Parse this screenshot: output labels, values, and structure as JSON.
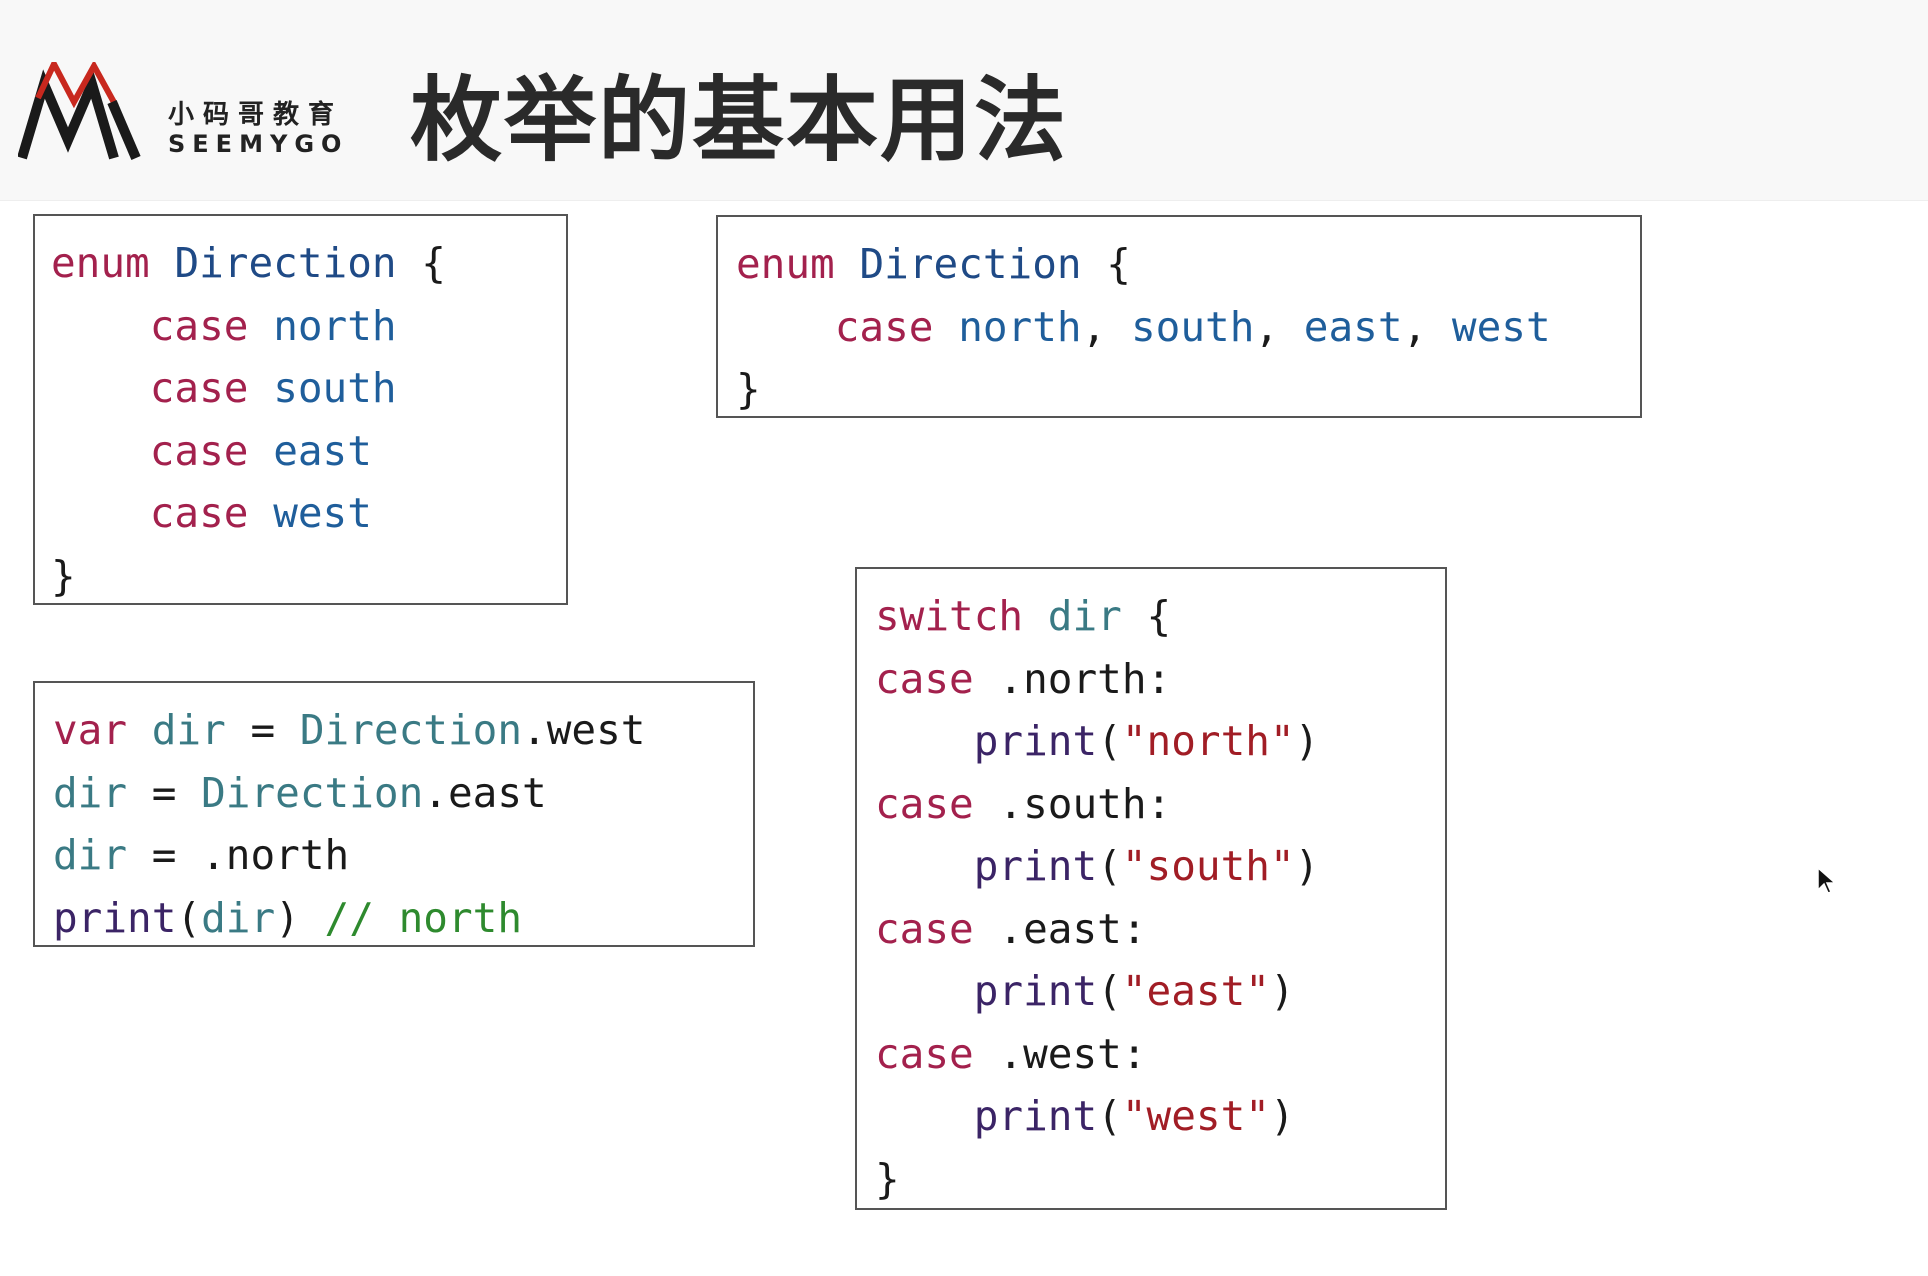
{
  "logo": {
    "cn_text": "小码哥教育",
    "en_text": "SEEMYGO",
    "colors": {
      "mark_dark": "#1a1a1a",
      "mark_red": "#c8281e"
    }
  },
  "title": "枚举的基本用法",
  "code_blocks": {
    "enum_separate": {
      "line1": {
        "kw": "enum",
        "name": "Direction",
        "brace": "{"
      },
      "cases": [
        {
          "kw": "case",
          "value": "north"
        },
        {
          "kw": "case",
          "value": "south"
        },
        {
          "kw": "case",
          "value": "east"
        },
        {
          "kw": "case",
          "value": "west"
        }
      ],
      "close": "}"
    },
    "enum_compact": {
      "line1": {
        "kw": "enum",
        "name": "Direction",
        "brace": "{"
      },
      "line2": {
        "kw": "case",
        "v1": "north",
        "v2": "south",
        "v3": "east",
        "v4": "west",
        "sep": ","
      },
      "close": "}"
    },
    "var_usage": {
      "l1": {
        "kw": "var",
        "var": "dir",
        "eq": "=",
        "type": "Direction",
        "member": ".west"
      },
      "l2": {
        "var": "dir",
        "eq": "=",
        "type": "Direction",
        "member": ".east"
      },
      "l3": {
        "var": "dir",
        "eq": "=",
        "member": ".north"
      },
      "l4": {
        "fn": "print",
        "open": "(",
        "arg": "dir",
        "close": ")",
        "comment": "// north"
      }
    },
    "switch_block": {
      "head": {
        "kw": "switch",
        "var": "dir",
        "brace": "{"
      },
      "branches": [
        {
          "kw": "case",
          "pattern": ".north:",
          "fn": "print",
          "open": "(",
          "str": "\"north\"",
          "close": ")"
        },
        {
          "kw": "case",
          "pattern": ".south:",
          "fn": "print",
          "open": "(",
          "str": "\"south\"",
          "close": ")"
        },
        {
          "kw": "case",
          "pattern": ".east:",
          "fn": "print",
          "open": "(",
          "str": "\"east\"",
          "close": ")"
        },
        {
          "kw": "case",
          "pattern": ".west:",
          "fn": "print",
          "open": "(",
          "str": "\"west\"",
          "close": ")"
        }
      ],
      "close": "}"
    }
  },
  "syntax_colors": {
    "keyword": "#a3214d",
    "type": "#1f4a86",
    "enum_value": "#1f5e9b",
    "variable": "#3a7a84",
    "function": "#3b2466",
    "string": "#a11d25",
    "comment": "#2e8a2e"
  }
}
